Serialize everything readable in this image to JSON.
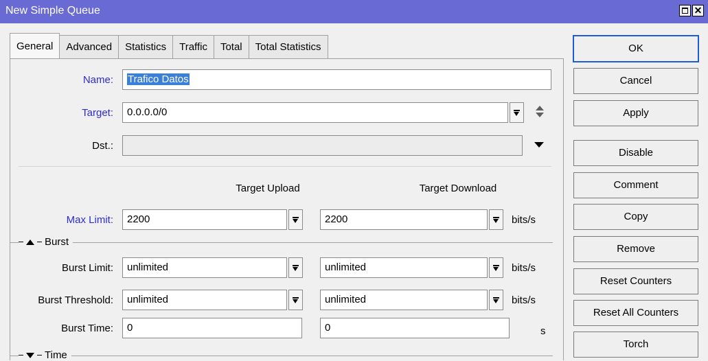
{
  "window": {
    "title": "New Simple Queue"
  },
  "tabs": [
    "General",
    "Advanced",
    "Statistics",
    "Traffic",
    "Total",
    "Total Statistics"
  ],
  "general": {
    "name_label": "Name:",
    "name_value": "Trafico Datos",
    "target_label": "Target:",
    "target_value": "0.0.0.0/0",
    "dst_label": "Dst.:",
    "dst_value": "",
    "col_upload": "Target Upload",
    "col_download": "Target Download",
    "max_limit_label": "Max Limit:",
    "max_limit_upload": "2200",
    "max_limit_download": "2200",
    "unit_bits": "bits/s",
    "burst_section": "Burst",
    "burst_limit_label": "Burst Limit:",
    "burst_limit_upload": "unlimited",
    "burst_limit_download": "unlimited",
    "burst_threshold_label": "Burst Threshold:",
    "burst_threshold_upload": "unlimited",
    "burst_threshold_download": "unlimited",
    "burst_time_label": "Burst Time:",
    "burst_time_upload": "0",
    "burst_time_download": "0",
    "unit_s": "s",
    "time_section": "Time"
  },
  "side_buttons": {
    "ok": "OK",
    "cancel": "Cancel",
    "apply": "Apply",
    "disable": "Disable",
    "comment": "Comment",
    "copy": "Copy",
    "remove": "Remove",
    "reset_counters": "Reset Counters",
    "reset_all_counters": "Reset All Counters",
    "torch": "Torch"
  },
  "colors": {
    "titlebar": "#6a6ad4",
    "label_blue": "#2b2bd6",
    "selection": "#3a7fd8"
  },
  "icons": [
    "maximize-icon",
    "close-icon",
    "dropdown-icon",
    "up-down-arrows-icon",
    "collapse-arrow-icon",
    "expand-arrow-icon"
  ]
}
